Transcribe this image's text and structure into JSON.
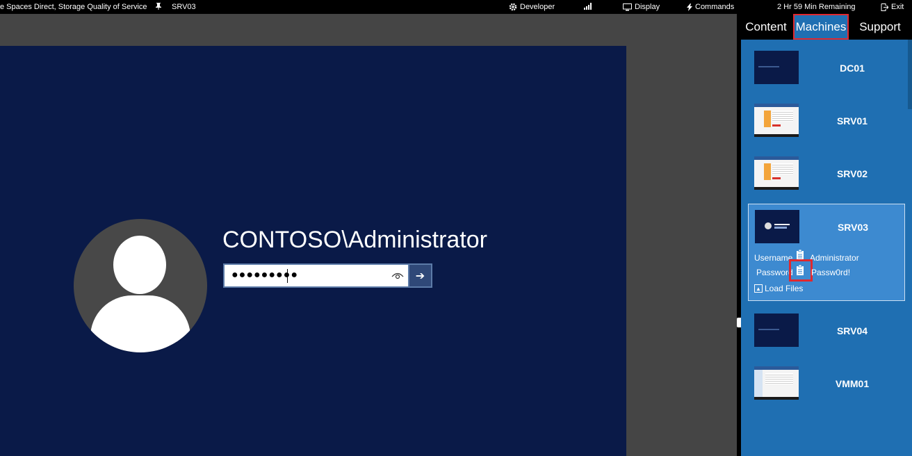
{
  "topbar": {
    "lab_title": "e Spaces Direct, Storage Quality of Service",
    "vm_name": "SRV03",
    "developer_label": "Developer",
    "display_label": "Display",
    "commands_label": "Commands",
    "time_remaining": "2 Hr 59 Min Remaining",
    "exit_label": "Exit"
  },
  "login": {
    "username": "CONTOSO\\Administrator",
    "password_masked": "●●●●●●●●●",
    "submit_arrow": "➔"
  },
  "tabs": [
    {
      "label": "Content"
    },
    {
      "label": "Machines"
    },
    {
      "label": "Support"
    }
  ],
  "machines": [
    {
      "name": "DC01"
    },
    {
      "name": "SRV01"
    },
    {
      "name": "SRV02"
    },
    {
      "name": "SRV03"
    },
    {
      "name": "SRV04"
    },
    {
      "name": "VMM01"
    }
  ],
  "selected_machine": {
    "username_label": "Username",
    "username_value": "Administrator",
    "password_label": "Password",
    "password_value": "Passw0rd!",
    "load_files_label": "Load Files"
  },
  "colors": {
    "panel": "#1f6fb2",
    "selected": "#3d8ad0",
    "vm_background": "#0a1a48",
    "highlight": "#e0282e"
  }
}
